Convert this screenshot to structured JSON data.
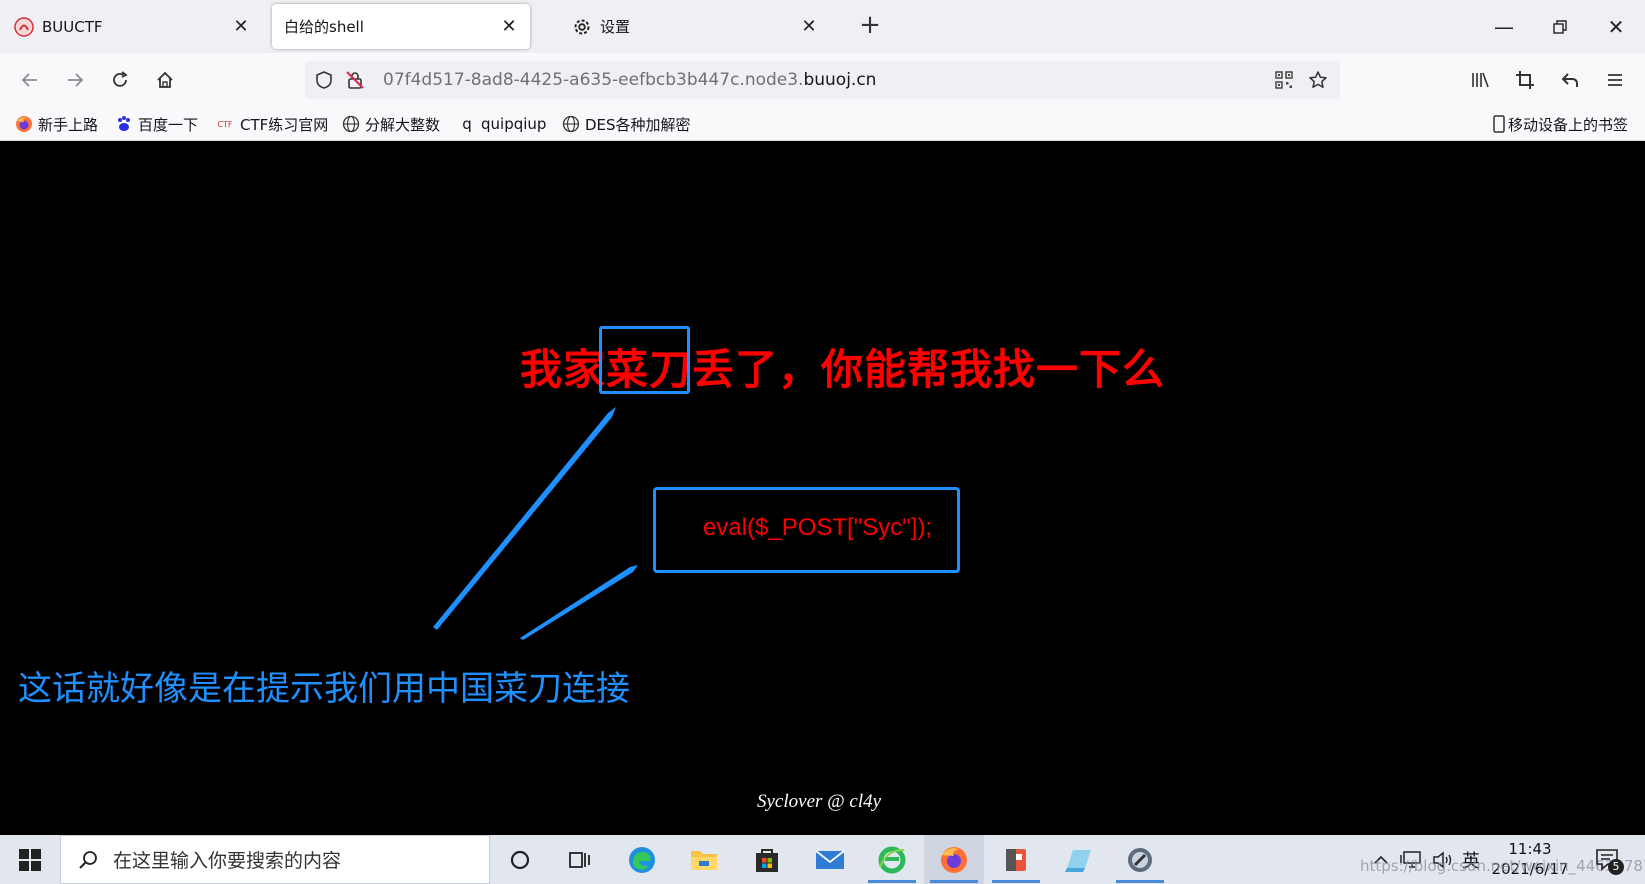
{
  "tabs": [
    {
      "title": "BUUCTF",
      "active": false
    },
    {
      "title": "白给的shell",
      "active": true
    },
    {
      "title": "设置",
      "active": false
    }
  ],
  "url": {
    "prefix": "07f4d517-8ad8-4425-a635-eefbcb3b447c.node3.",
    "domain": "buuoj.cn"
  },
  "bookmarks": [
    {
      "label": "新手上路",
      "icon": "firefox-icon"
    },
    {
      "label": "百度一下",
      "icon": "baidu-paw-icon"
    },
    {
      "label": "CTF练习官网",
      "icon": "ctf-logo-icon"
    },
    {
      "label": "分解大整数",
      "icon": "globe-icon"
    },
    {
      "label": "quipqiup",
      "icon": "q-icon"
    },
    {
      "label": "DES各种加解密",
      "icon": "globe-icon"
    }
  ],
  "mobile_bookmarks": "移动设备上的书签",
  "page": {
    "headline": "我家菜刀丢了，你能帮我找一下么",
    "code": "eval($_POST[\"Syc\"]);",
    "annotation": "这话就好像是在提示我们用中国菜刀连接",
    "signature": "Syclover @ cl4y"
  },
  "taskbar": {
    "search_placeholder": "在这里输入你要搜索的内容",
    "ime": "英",
    "time": "11:43",
    "date": "2021/6/17",
    "notification_count": "5",
    "watermark": "https://blog.csdn.net/weixin_44632787"
  },
  "colors": {
    "headline": "#ff0000",
    "annotation": "#1e90ff",
    "highlight_box": "#1e90ff"
  }
}
